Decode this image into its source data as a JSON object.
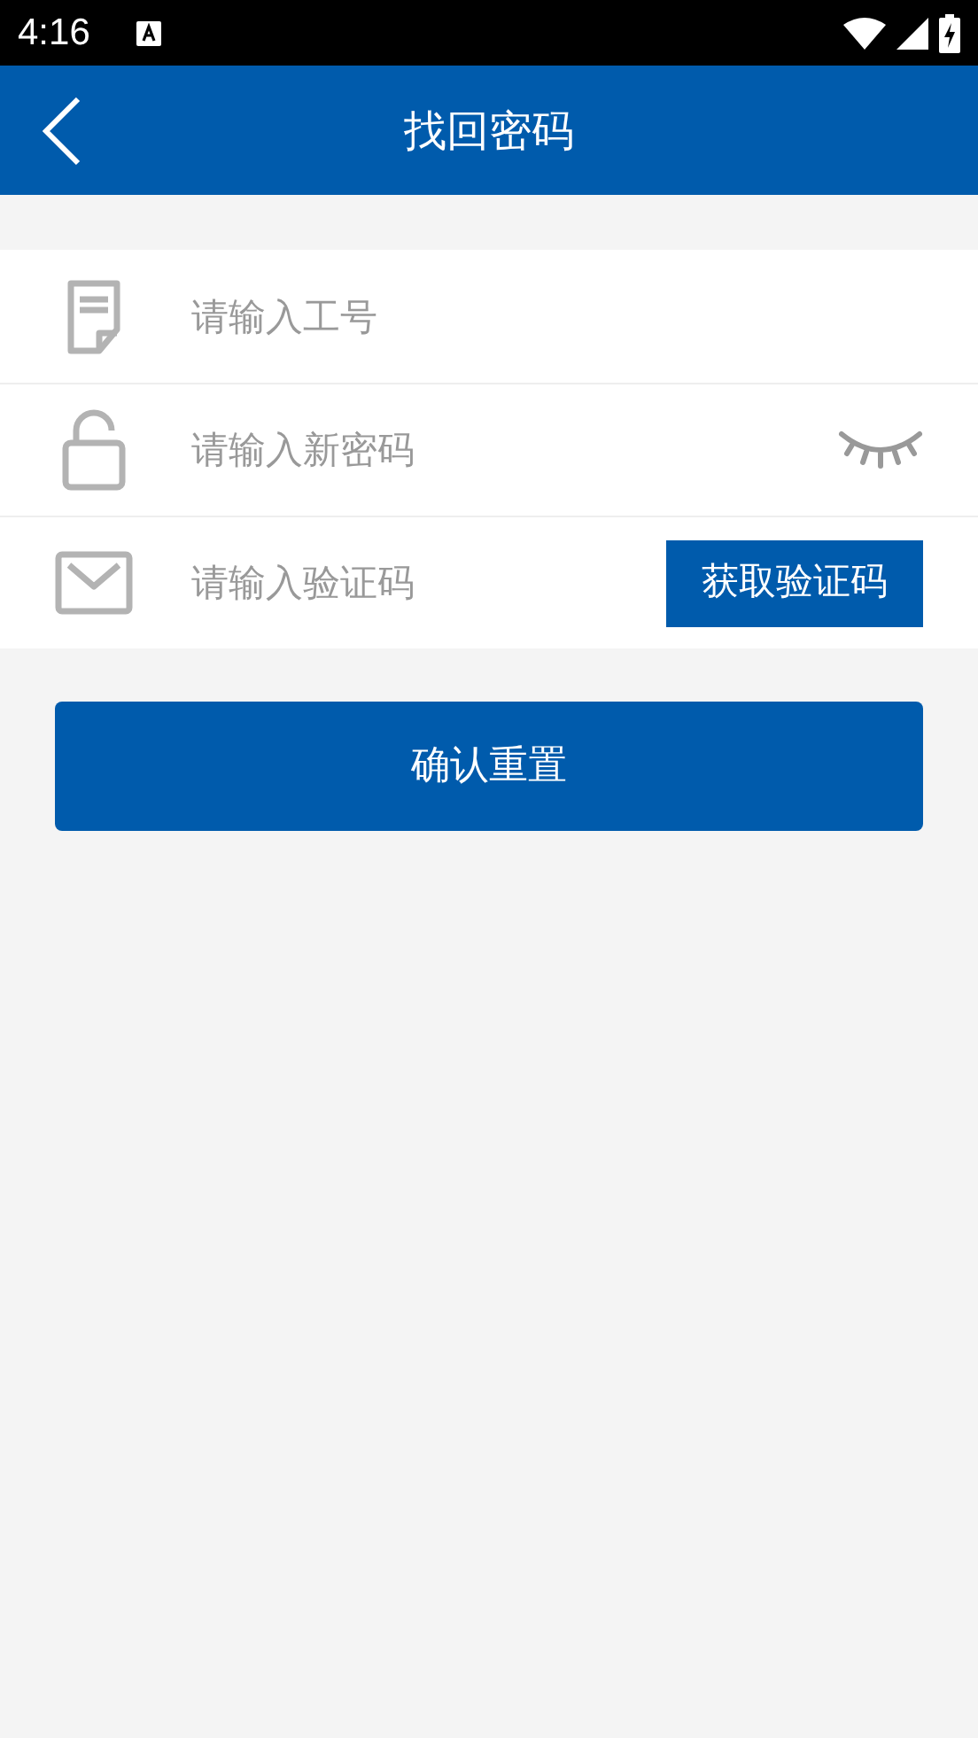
{
  "status_bar": {
    "time": "4:16"
  },
  "header": {
    "title": "找回密码"
  },
  "fields": [
    {
      "kind": "id",
      "placeholder": "请输入工号"
    },
    {
      "kind": "password",
      "placeholder": "请输入新密码",
      "visible": false
    },
    {
      "kind": "code",
      "placeholder": "请输入验证码",
      "button": "获取验证码"
    }
  ],
  "submit": "确认重置"
}
